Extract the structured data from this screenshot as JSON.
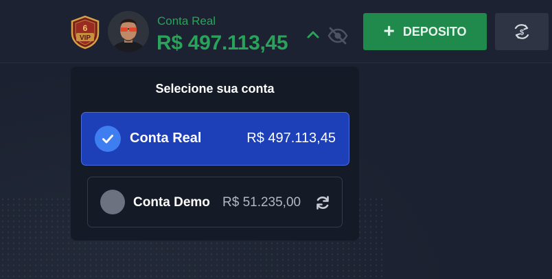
{
  "header": {
    "vip_badge": {
      "level": "6",
      "label": "VIP",
      "icon": "vip-shield-icon"
    },
    "account_label": "Conta Real",
    "account_balance": "R$ 497.113,45",
    "deposit_label": "DEPOSITO",
    "icons": {
      "toggle": "chevron-up-icon",
      "visibility": "eye-slash-icon",
      "exchange": "currency-exchange-icon"
    }
  },
  "account_selector": {
    "title": "Selecione sua conta",
    "options": [
      {
        "name": "Conta Real",
        "balance": "R$ 497.113,45",
        "selected": true
      },
      {
        "name": "Conta Demo",
        "balance": "R$ 51.235,00",
        "selected": false
      }
    ]
  },
  "colors": {
    "accent_green": "#2aa35a",
    "deposit_green": "#1f8a4c",
    "selected_blue": "#1d3fb7",
    "background": "#1b2130"
  }
}
